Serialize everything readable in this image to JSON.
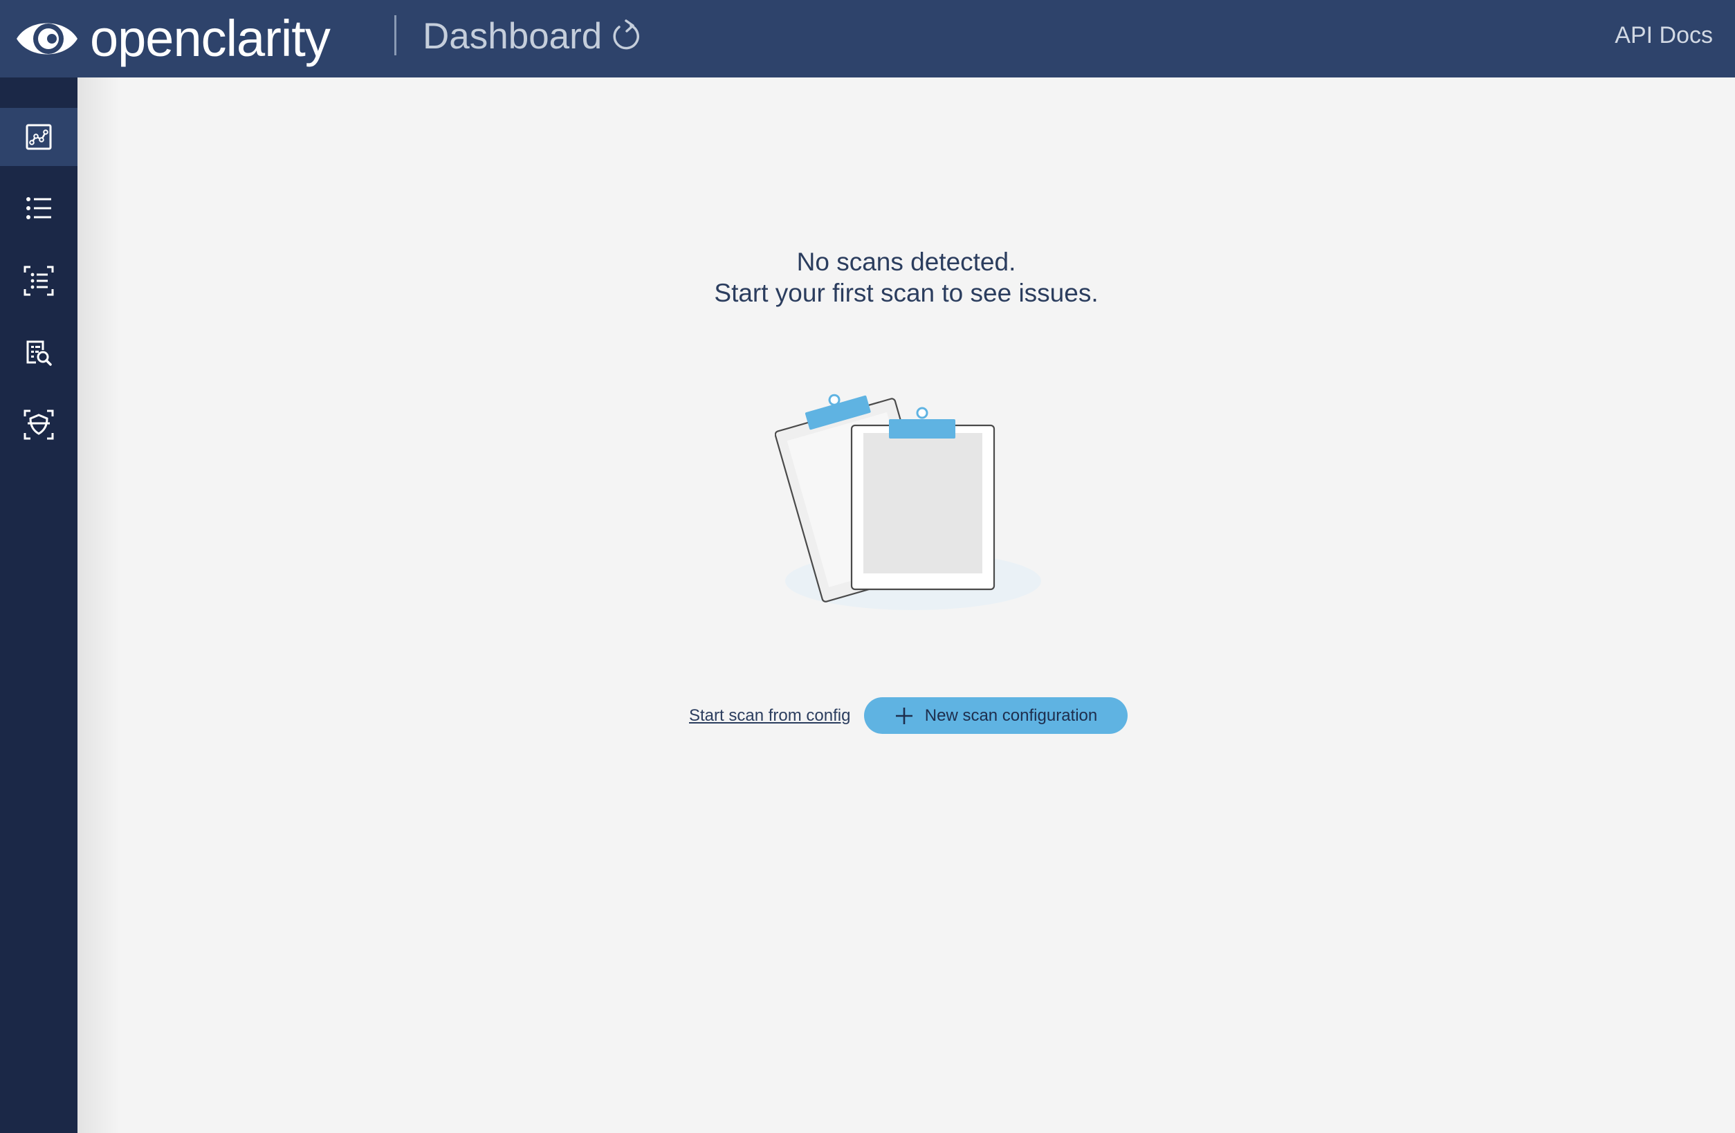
{
  "header": {
    "logo_text": "openclarity",
    "page_title": "Dashboard",
    "api_docs_label": "API Docs",
    "refresh_icon": "refresh-icon"
  },
  "sidebar": {
    "items": [
      {
        "name": "dashboard",
        "icon": "dashboard-chart-icon",
        "active": true
      },
      {
        "name": "list",
        "icon": "list-icon",
        "active": false
      },
      {
        "name": "scan-list",
        "icon": "scan-list-icon",
        "active": false
      },
      {
        "name": "findings",
        "icon": "document-search-icon",
        "active": false
      },
      {
        "name": "security",
        "icon": "shield-scan-icon",
        "active": false
      }
    ]
  },
  "main": {
    "empty_line_1": "No scans detected.",
    "empty_line_2": "Start your first scan to see issues.",
    "illustration": "clipboards-illustration",
    "start_from_config_label": "Start scan from config",
    "new_scan_label": "New scan configuration"
  },
  "colors": {
    "header_bg": "#2e436b",
    "sidebar_bg": "#1b2847",
    "content_bg": "#f4f4f4",
    "accent": "#5fb3e2",
    "text_dark": "#2b3d5e"
  }
}
